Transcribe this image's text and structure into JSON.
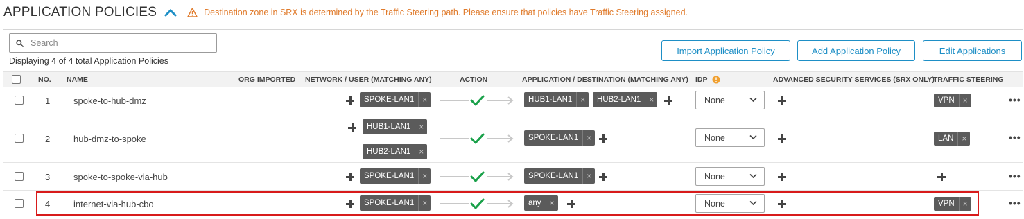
{
  "header": {
    "title": "APPLICATION POLICIES",
    "warning": "Destination zone in SRX is determined by the Traffic Steering path. Please ensure that policies have Traffic Steering assigned."
  },
  "search": {
    "placeholder": "Search"
  },
  "count_text": "Displaying 4 of 4 total Application Policies",
  "buttons": {
    "import": "Import Application Policy",
    "add": "Add Application Policy",
    "edit": "Edit Applications"
  },
  "columns": {
    "no": "NO.",
    "name": "NAME",
    "org_imported": "ORG IMPORTED",
    "network": "NETWORK / USER (MATCHING ANY)",
    "action": "ACTION",
    "application": "APPLICATION / DESTINATION (MATCHING ANY)",
    "idp": "IDP",
    "advanced": "ADVANCED SECURITY SERVICES (SRX ONLY)",
    "steering": "TRAFFIC STEERING"
  },
  "rows": [
    {
      "no": "1",
      "name": "spoke-to-hub-dmz",
      "networks": [
        "SPOKE-LAN1"
      ],
      "applications": [
        "HUB1-LAN1",
        "HUB2-LAN1"
      ],
      "idp": "None",
      "steering": "VPN"
    },
    {
      "no": "2",
      "name": "hub-dmz-to-spoke",
      "networks": [
        "HUB1-LAN1",
        "HUB2-LAN1"
      ],
      "applications": [
        "SPOKE-LAN1"
      ],
      "idp": "None",
      "steering": "LAN"
    },
    {
      "no": "3",
      "name": "spoke-to-spoke-via-hub",
      "networks": [
        "SPOKE-LAN1"
      ],
      "applications": [
        "SPOKE-LAN1"
      ],
      "idp": "None",
      "steering": ""
    },
    {
      "no": "4",
      "name": "internet-via-hub-cbo",
      "networks": [
        "SPOKE-LAN1"
      ],
      "applications": [
        "any"
      ],
      "idp": "None",
      "steering": "VPN"
    }
  ],
  "remove_glyph": "×",
  "more_glyph": "•••",
  "colors": {
    "accent": "#1e8fc6",
    "warning": "#e07b2c",
    "allow": "#1aa14a",
    "highlight": "#d81b1b",
    "tag": "#5b5b5b"
  }
}
